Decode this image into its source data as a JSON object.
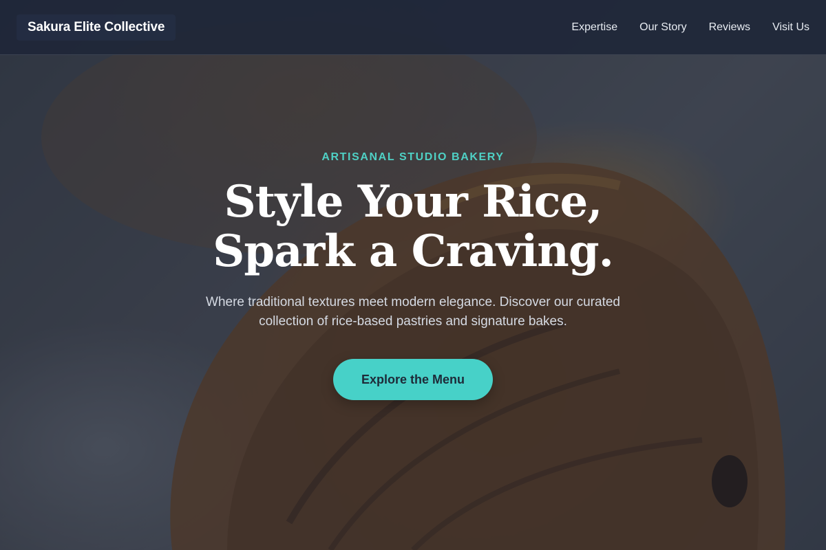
{
  "header": {
    "brand": "Sakura Elite Collective",
    "nav": [
      {
        "label": "Expertise"
      },
      {
        "label": "Our Story"
      },
      {
        "label": "Reviews"
      },
      {
        "label": "Visit Us"
      }
    ]
  },
  "hero": {
    "eyebrow": "ARTISANAL STUDIO BAKERY",
    "headline_line1": "Style Your Rice,",
    "headline_line2": "Spark a Craving.",
    "subtext": "Where traditional textures meet modern elegance. Discover our curated collection of rice-based pastries and signature bakes.",
    "cta_label": "Explore the Menu",
    "background_image": "croissant-pastry-photo"
  },
  "colors": {
    "accent": "#47d1c8",
    "eyebrow": "#4fd1c5",
    "header_bg": "#1e2638",
    "overlay": "#1a2030",
    "text_light": "#ffffff"
  }
}
